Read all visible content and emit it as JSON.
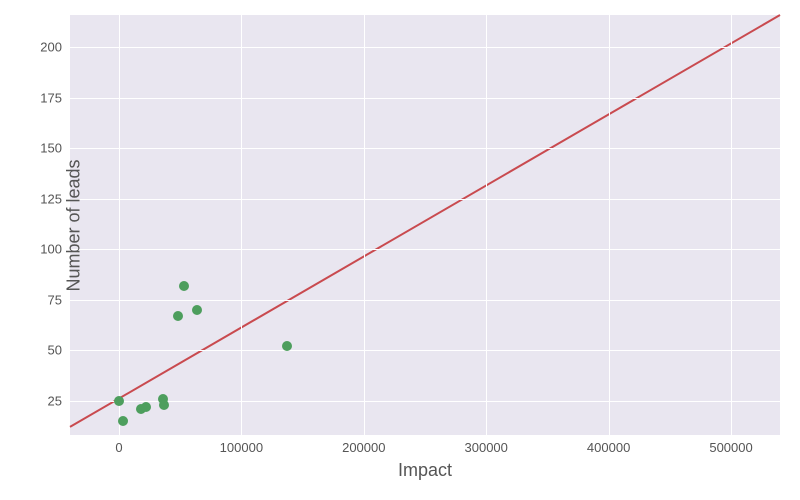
{
  "chart_data": {
    "type": "scatter",
    "xlabel": "Impact",
    "ylabel": "Number of leads",
    "xlim": [
      -40000,
      540000
    ],
    "ylim": [
      8,
      216
    ],
    "xticks": [
      0,
      100000,
      200000,
      300000,
      400000,
      500000
    ],
    "yticks": [
      25,
      50,
      75,
      100,
      125,
      150,
      175,
      200
    ],
    "points": [
      {
        "x": 0,
        "y": 25
      },
      {
        "x": 3000,
        "y": 15
      },
      {
        "x": 18000,
        "y": 21
      },
      {
        "x": 22000,
        "y": 22
      },
      {
        "x": 36000,
        "y": 26
      },
      {
        "x": 37000,
        "y": 23
      },
      {
        "x": 48000,
        "y": 67
      },
      {
        "x": 53000,
        "y": 82
      },
      {
        "x": 64000,
        "y": 70
      },
      {
        "x": 137000,
        "y": 52
      }
    ],
    "regression": {
      "x0": -40000,
      "y0": 12,
      "x1": 540000,
      "y1": 216,
      "color": "#c94a4f"
    },
    "point_color": "#4d9e5d",
    "bg": "#e9e6f0"
  }
}
